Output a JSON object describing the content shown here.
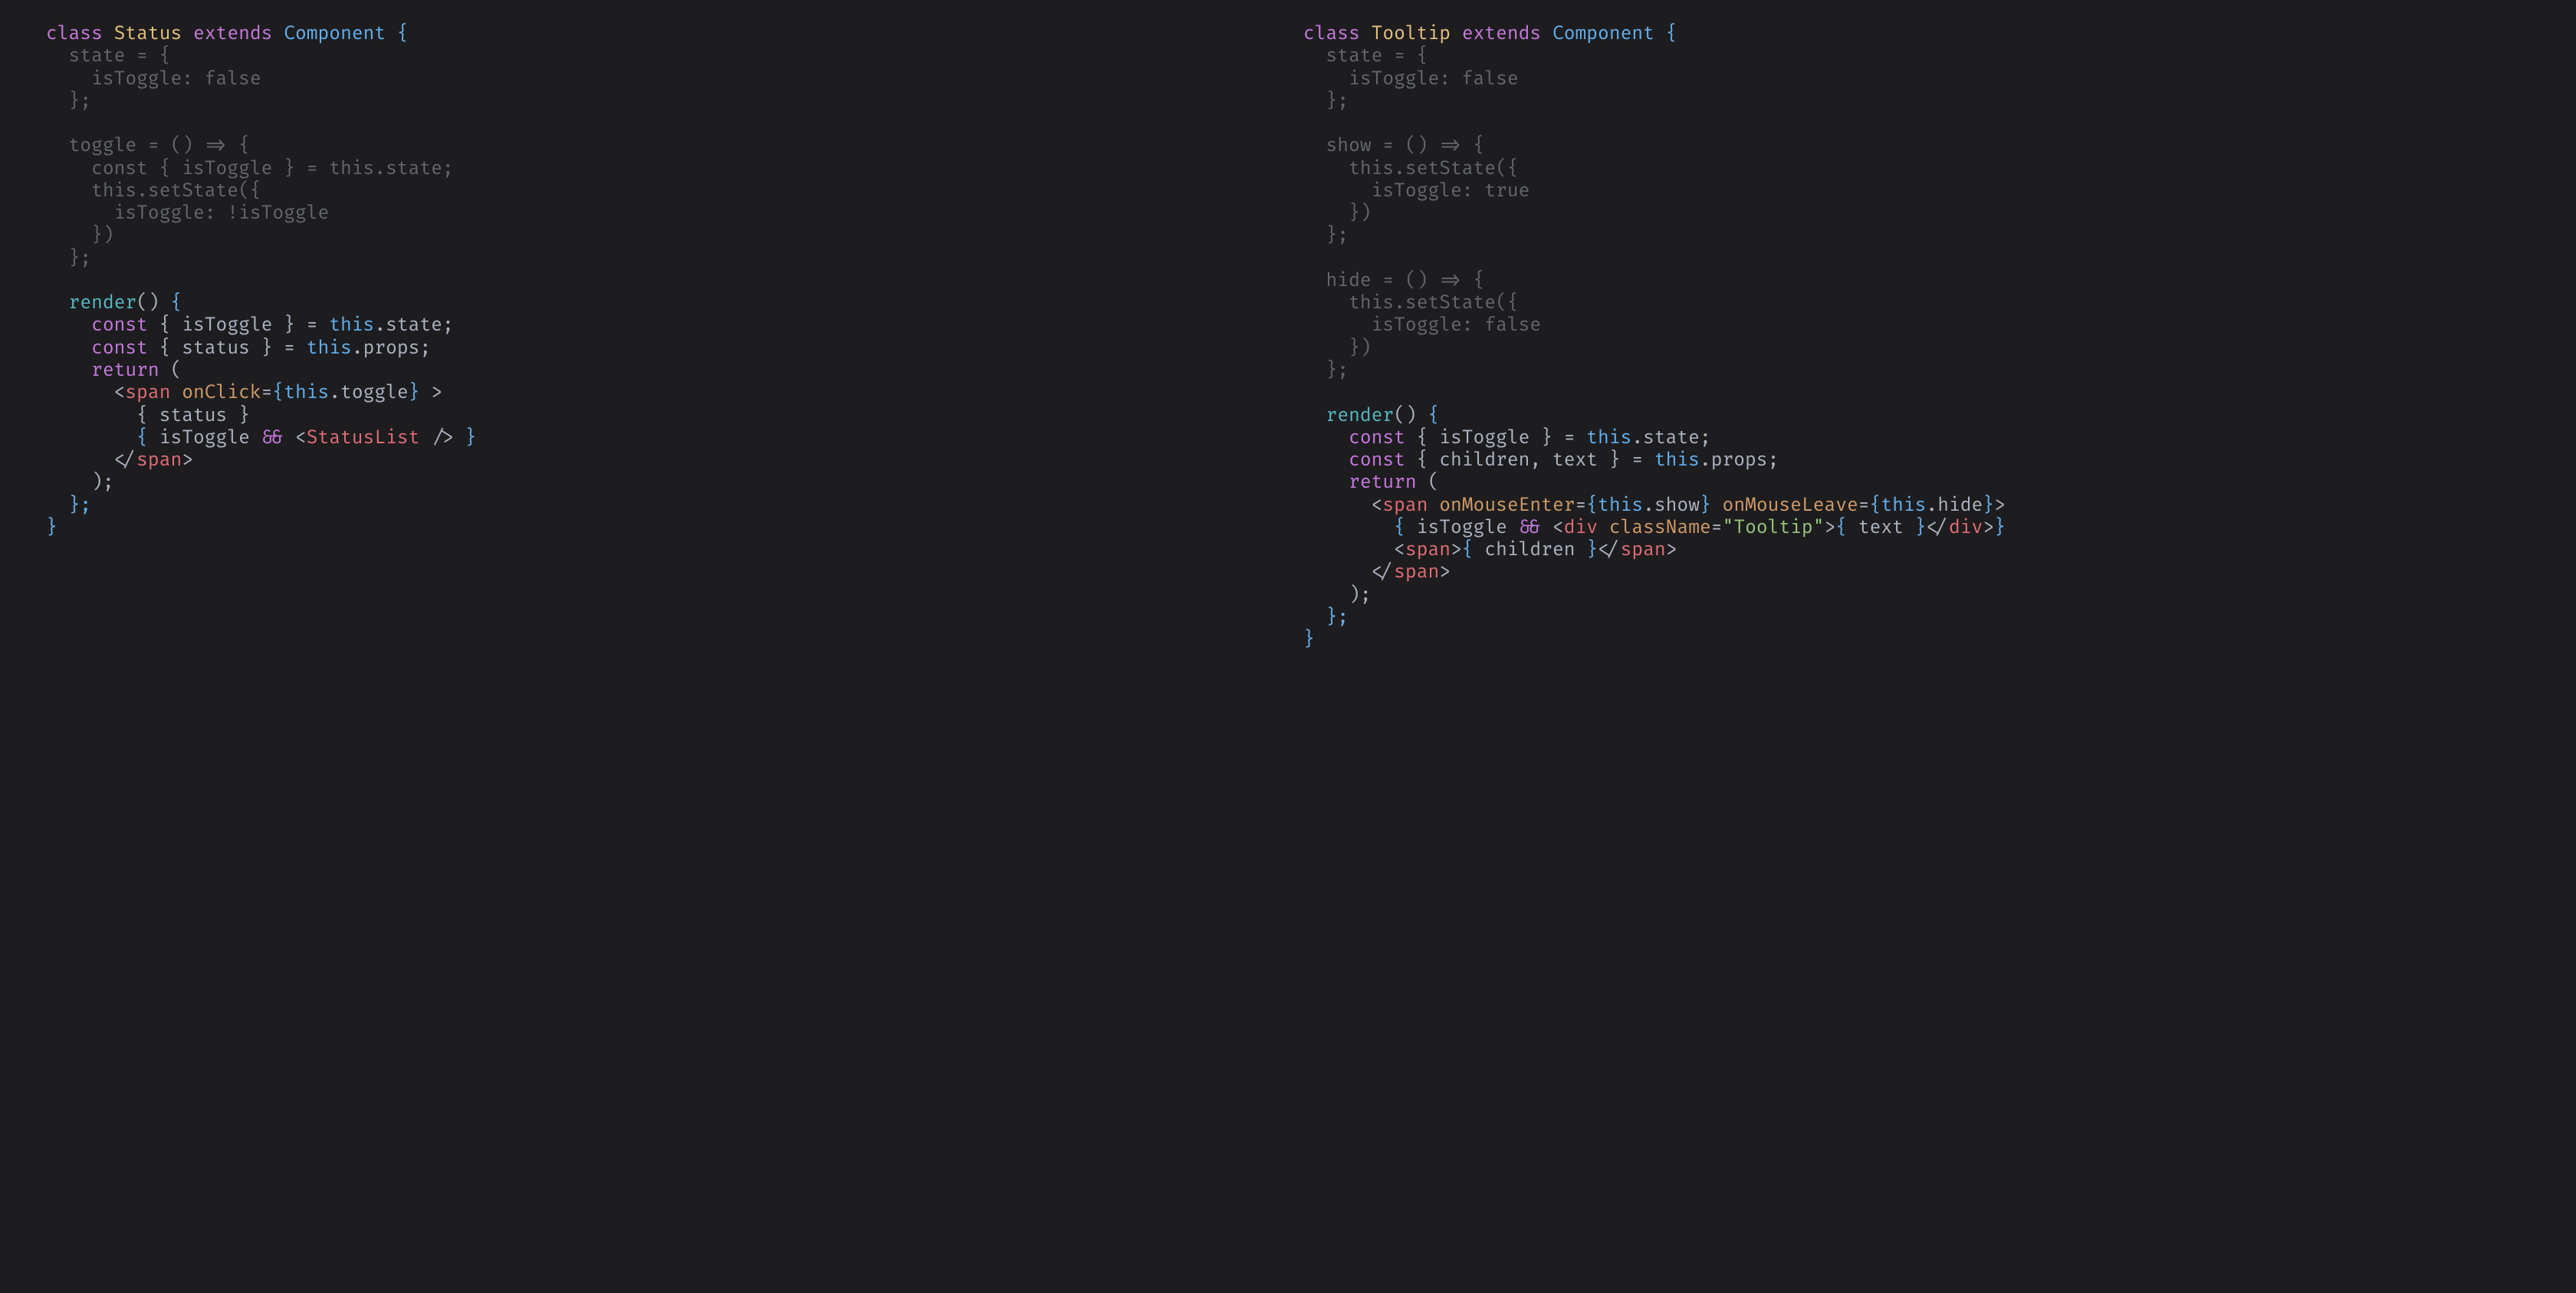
{
  "left": {
    "l1_class": "class",
    "l1_name": "Status",
    "l1_extends": "extends",
    "l1_component": "Component",
    "l1_brace": " {",
    "l2": "  state = {",
    "l3": "    isToggle: false",
    "l4": "  };",
    "l5": "",
    "l6": "  toggle = () => {",
    "l7": "    const { isToggle } = this.state;",
    "l8": "    this.setState({",
    "l9": "      isToggle: !isToggle",
    "l10": "    })",
    "l11": "  };",
    "l12": "",
    "l13_a": "  ",
    "l13_render": "render",
    "l13_b": "() ",
    "l13_brace": "{",
    "l14_a": "    ",
    "l14_const": "const",
    "l14_b": " { isToggle } = ",
    "l14_this": "this",
    "l14_c": ".state;",
    "l15_a": "    ",
    "l15_const": "const",
    "l15_b": " { status } = ",
    "l15_this": "this",
    "l15_c": ".props;",
    "l16_a": "    ",
    "l16_return": "return",
    "l16_b": " (",
    "l17_a": "      <",
    "l17_span": "span",
    "l17_b": " ",
    "l17_onclick": "onClick",
    "l17_c": "=",
    "l17_lb": "{",
    "l17_this": "this",
    "l17_d": ".toggle",
    "l17_rb": "}",
    "l17_e": " >",
    "l18": "        { status }",
    "l19_a": "        ",
    "l19_lb": "{",
    "l19_b": " isToggle ",
    "l19_amp": "&&",
    "l19_c": " <",
    "l19_sl": "StatusList",
    "l19_d": " />",
    "l19_sp": " ",
    "l19_rb": "}",
    "l20_a": "      </",
    "l20_span": "span",
    "l20_b": ">",
    "l21": "    );",
    "l22": "  };",
    "l23": "}"
  },
  "right": {
    "l1_class": "class",
    "l1_name": "Tooltip",
    "l1_extends": "extends",
    "l1_component": "Component",
    "l1_brace": " {",
    "l2": "  state = {",
    "l3": "    isToggle: false",
    "l4": "  };",
    "l5": "",
    "l6": "  show = () => {",
    "l7": "    this.setState({",
    "l8": "      isToggle: true",
    "l9": "    })",
    "l10": "  };",
    "l11": "",
    "l12": "  hide = () => {",
    "l13": "    this.setState({",
    "l14": "      isToggle: false",
    "l15": "    })",
    "l16": "  };",
    "l17": "",
    "l18_a": "  ",
    "l18_render": "render",
    "l18_b": "() ",
    "l18_brace": "{",
    "l19_a": "    ",
    "l19_const": "const",
    "l19_b": " { isToggle } = ",
    "l19_this": "this",
    "l19_c": ".state;",
    "l20_a": "    ",
    "l20_const": "const",
    "l20_b": " { children, text } = ",
    "l20_this": "this",
    "l20_c": ".props;",
    "l21_a": "    ",
    "l21_return": "return",
    "l21_b": " (",
    "l22_a": "      <",
    "l22_span": "span",
    "l22_b": " ",
    "l22_ome": "onMouseEnter",
    "l22_c": "=",
    "l22_lb1": "{",
    "l22_this1": "this",
    "l22_d": ".show",
    "l22_rb1": "}",
    "l22_e": " ",
    "l22_oml": "onMouseLeave",
    "l22_f": "=",
    "l22_lb2": "{",
    "l22_this2": "this",
    "l22_g": ".hide",
    "l22_rb2": "}",
    "l22_h": ">",
    "l23_a": "        ",
    "l23_lb": "{",
    "l23_b": " isToggle ",
    "l23_amp": "&&",
    "l23_c": " <",
    "l23_div": "div",
    "l23_d": " ",
    "l23_cn": "className",
    "l23_e": "=",
    "l23_str": "\"Tooltip\"",
    "l23_f": ">",
    "l23_lb2": "{",
    "l23_g": " text ",
    "l23_rb2": "}",
    "l23_h": "</",
    "l23_div2": "div",
    "l23_i": ">",
    "l23_rb": "}",
    "l24_a": "        <",
    "l24_span": "span",
    "l24_b": ">",
    "l24_lb": "{",
    "l24_c": " children ",
    "l24_rb": "}",
    "l24_d": "</",
    "l24_span2": "span",
    "l24_e": ">",
    "l25_a": "      </",
    "l25_span": "span",
    "l25_b": ">",
    "l26": "    );",
    "l27": "  };",
    "l28": "}"
  }
}
